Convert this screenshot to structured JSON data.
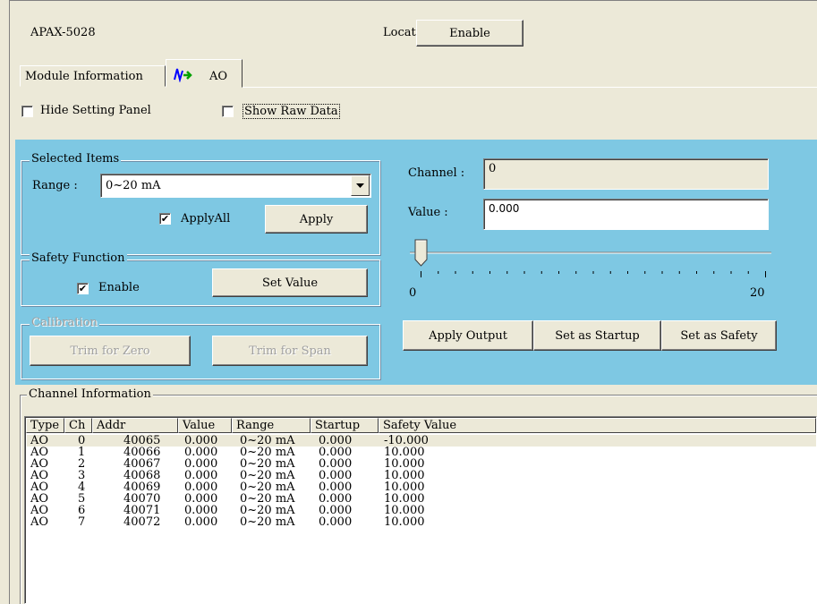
{
  "header": {
    "module_name": "APAX-5028",
    "locate_label": "Locate",
    "enable_button": "Enable"
  },
  "tabs": [
    {
      "label": "Module Information"
    },
    {
      "label": "AO",
      "icon": "ao-signal-icon"
    }
  ],
  "options": {
    "hide_setting_panel": "Hide Setting Panel",
    "show_raw_data": "Show Raw Data"
  },
  "selected_items": {
    "title": "Selected Items",
    "range_label": "Range :",
    "range_value": "0~20 mA",
    "apply_all_label": "ApplyAll",
    "apply_button": "Apply"
  },
  "safety": {
    "title": "Safety Function",
    "enable_label": "Enable",
    "set_value_button": "Set Value"
  },
  "calibration": {
    "title": "Calibration",
    "trim_zero": "Trim for Zero",
    "trim_span": "Trim for Span"
  },
  "output": {
    "channel_label": "Channel :",
    "channel_value": "0",
    "value_label": "Value :",
    "value_value": "0.000",
    "slider_min": "0",
    "slider_max": "20",
    "slider_value": 0,
    "apply_output": "Apply Output",
    "set_startup": "Set as Startup",
    "set_safety": "Set as Safety"
  },
  "channel_info": {
    "title": "Channel Information",
    "columns": [
      "Type",
      "Ch",
      "Addr",
      "Value",
      "Range",
      "Startup",
      "Safety Value"
    ],
    "rows": [
      [
        "AO",
        "0",
        "40065",
        "0.000",
        "0~20 mA",
        "0.000",
        "-10.000"
      ],
      [
        "AO",
        "1",
        "40066",
        "0.000",
        "0~20 mA",
        "0.000",
        "10.000"
      ],
      [
        "AO",
        "2",
        "40067",
        "0.000",
        "0~20 mA",
        "0.000",
        "10.000"
      ],
      [
        "AO",
        "3",
        "40068",
        "0.000",
        "0~20 mA",
        "0.000",
        "10.000"
      ],
      [
        "AO",
        "4",
        "40069",
        "0.000",
        "0~20 mA",
        "0.000",
        "10.000"
      ],
      [
        "AO",
        "5",
        "40070",
        "0.000",
        "0~20 mA",
        "0.000",
        "10.000"
      ],
      [
        "AO",
        "6",
        "40071",
        "0.000",
        "0~20 mA",
        "0.000",
        "10.000"
      ],
      [
        "AO",
        "7",
        "40072",
        "0.000",
        "0~20 mA",
        "0.000",
        "10.000"
      ]
    ]
  },
  "colors": {
    "panel_blue": "#7ec8e3",
    "window_bg": "#ece9d8"
  }
}
